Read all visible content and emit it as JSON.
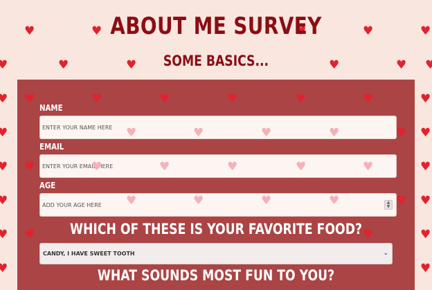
{
  "page": {
    "title": "ABOUT ME SURVEY",
    "subtitle": "SOME BASICS..."
  },
  "form": {
    "name_label": "NAME",
    "name_placeholder": "ENTER YOUR NAME HERE",
    "email_label": "EMAIL",
    "email_placeholder": "ENTER YOUR EMAIL HERE",
    "age_label": "AGE",
    "age_placeholder": "ADD YOUR AGE HERE",
    "food_question": "WHICH OF THESE IS YOUR FAVORITE FOOD?",
    "food_selected": "CANDY, I HAVE SWEET TOOTH",
    "fun_question": "WHAT SOUNDS MOST FUN TO YOU?"
  },
  "icons": {
    "heart": "♥",
    "chevron": "⌄",
    "spinner_up": "▲",
    "spinner_down": "▼"
  },
  "colors": {
    "background": "#f8e6df",
    "heart": "#e0232d",
    "heading": "#8a0e14",
    "panel": "#ab4444"
  }
}
